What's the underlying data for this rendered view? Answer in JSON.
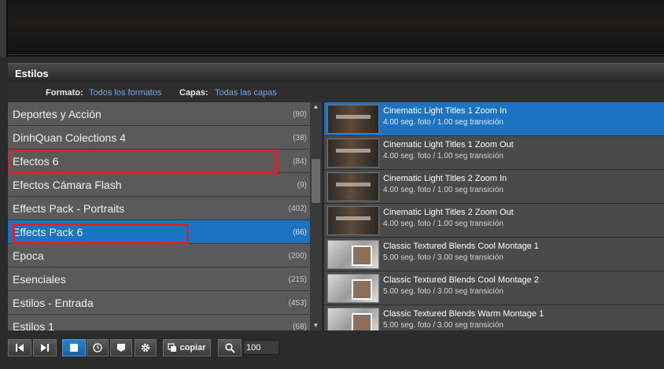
{
  "panel": {
    "title": "Estilos"
  },
  "filters": {
    "format_label": "Formato:",
    "format_value": "Todos los formatos",
    "layers_label": "Capas:",
    "layers_value": "Todas las capas"
  },
  "categories": [
    {
      "name": "Deportes y Acción",
      "count": "(80)"
    },
    {
      "name": "DinhQuan Colections 4",
      "count": "(38)"
    },
    {
      "name": "Efectos 6",
      "count": "(84)"
    },
    {
      "name": "Efectos Cámara Flash",
      "count": "(9)"
    },
    {
      "name": "Effects Pack - Portraits",
      "count": "(402)"
    },
    {
      "name": "Effects Pack 6",
      "count": "(66)",
      "selected": true
    },
    {
      "name": "Epoca",
      "count": "(200)"
    },
    {
      "name": "Esenciales",
      "count": "(215)"
    },
    {
      "name": "Estilos - Entrada",
      "count": "(453)"
    },
    {
      "name": "Estilos 1",
      "count": "(68)"
    }
  ],
  "styles": [
    {
      "title": "Cinematic Light Titles 1 Zoom In",
      "detail": "4.00 seg. foto / 1.00 seg transición",
      "thumb": "dark",
      "selected": true
    },
    {
      "title": "Cinematic Light Titles 1 Zoom Out",
      "detail": "4.00 seg. foto / 1.00 seg transición",
      "thumb": "dark"
    },
    {
      "title": "Cinematic Light Titles 2 Zoom In",
      "detail": "4.00 seg. foto / 1.00 seg transición",
      "thumb": "dark"
    },
    {
      "title": "Cinematic Light Titles 2 Zoom Out",
      "detail": "4.00 seg. foto / 1.00 seg transición",
      "thumb": "dark"
    },
    {
      "title": "Classic Textured Blends Cool Montage 1",
      "detail": "5.00 seg. foto / 3.00 seg transición",
      "thumb": "light"
    },
    {
      "title": "Classic Textured Blends Cool Montage 2",
      "detail": "5.00 seg. foto / 3.00 seg transición",
      "thumb": "light"
    },
    {
      "title": "Classic Textured Blends Warm Montage 1",
      "detail": "5.00 seg. foto / 3.00 seg transición",
      "thumb": "light"
    }
  ],
  "toolbar": {
    "copy_label": "copiar",
    "zoom_value": "100"
  },
  "colors": {
    "selection": "#1c73c4",
    "highlight_box": "#e0202a",
    "link": "#6fa8e8"
  }
}
